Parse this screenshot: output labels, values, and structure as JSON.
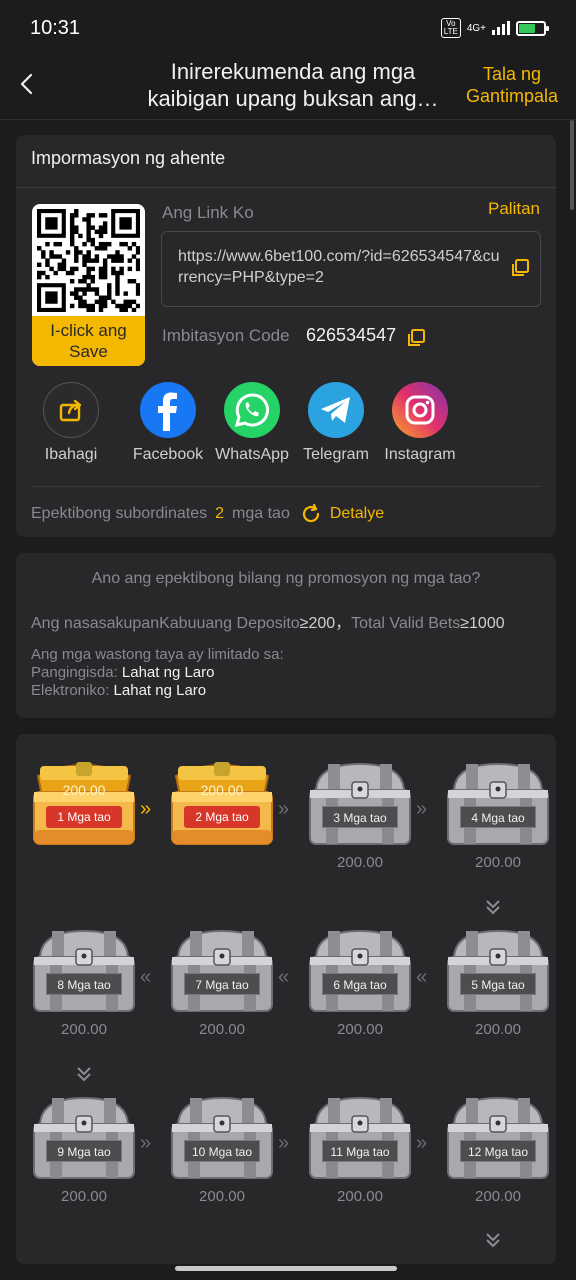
{
  "status": {
    "time": "10:31",
    "volte": "Vo\nLTE",
    "net": "4G+",
    "battery_level": 0.6
  },
  "header": {
    "title": "Inirerekumenda ang mga kaibigan upang buksan ang…",
    "reward_link": "Tala ng Gantimpala"
  },
  "agent": {
    "title": "Impormasyon ng ahente",
    "qr_button": "I-click ang Save",
    "link_label": "Ang Link Ko",
    "change": "Palitan",
    "link": "https://www.6bet100.com/?id=626534547&currency=PHP&type=2",
    "code_label": "Imbitasyon Code",
    "code": "626534547",
    "shares": [
      {
        "label": "Ibahagi",
        "icon": "share-icon",
        "color": "#2b2b2d"
      },
      {
        "label": "Facebook",
        "icon": "facebook-icon",
        "color": "#1877f2"
      },
      {
        "label": "WhatsApp",
        "icon": "whatsapp-icon",
        "color": "#25d366"
      },
      {
        "label": "Telegram",
        "icon": "telegram-icon",
        "color": "#2aa3e0"
      },
      {
        "label": "Instagram",
        "icon": "instagram-icon",
        "color": "#e1306c"
      }
    ],
    "subs_label": "Epektibong subordinates",
    "subs_count": "2",
    "subs_unit": "mga tao",
    "detail": "Detalye"
  },
  "rules": {
    "question": "Ano ang epektibong bilang ng promosyon ng mga tao?",
    "condition_prefix": "Ang nasasakupanKabuuang Deposito",
    "condition_deposit": "≥200，",
    "condition_bets_label": "Total Valid Bets",
    "condition_bets": "≥1000",
    "limited_intro": "Ang mga wastong taya ay limitado sa:",
    "fishing_label": "Pangingisda: ",
    "fishing_value": "Lahat ng Laro",
    "electronic_label": "Elektroniko: ",
    "electronic_value": "Lahat ng Laro"
  },
  "chests": [
    {
      "label": "1 Mga tao",
      "amount": "200.00",
      "opened": true
    },
    {
      "label": "2 Mga tao",
      "amount": "200.00",
      "opened": true
    },
    {
      "label": "3 Mga tao",
      "amount": "200.00",
      "opened": false
    },
    {
      "label": "4 Mga tao",
      "amount": "200.00",
      "opened": false
    },
    {
      "label": "5 Mga tao",
      "amount": "200.00",
      "opened": false
    },
    {
      "label": "6 Mga tao",
      "amount": "200.00",
      "opened": false
    },
    {
      "label": "7 Mga tao",
      "amount": "200.00",
      "opened": false
    },
    {
      "label": "8 Mga tao",
      "amount": "200.00",
      "opened": false
    },
    {
      "label": "9 Mga tao",
      "amount": "200.00",
      "opened": false
    },
    {
      "label": "10 Mga tao",
      "amount": "200.00",
      "opened": false
    },
    {
      "label": "11 Mga tao",
      "amount": "200.00",
      "opened": false
    },
    {
      "label": "12 Mga tao",
      "amount": "200.00",
      "opened": false
    }
  ],
  "colors": {
    "accent": "#f5b800",
    "background": "#1c1c1e",
    "card": "#28282a"
  }
}
